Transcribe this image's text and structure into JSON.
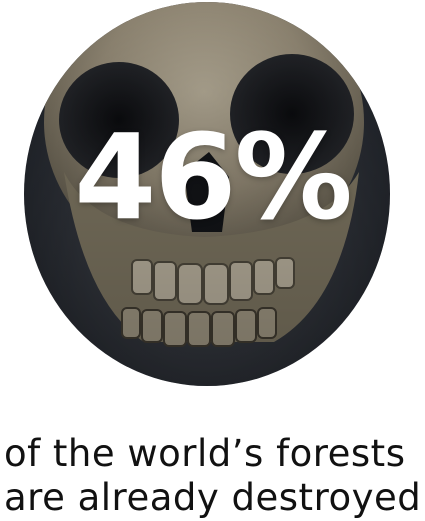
{
  "stat": {
    "value": "46%"
  },
  "caption": {
    "line1": "of the world’s forests",
    "line2": "are already destroyed"
  },
  "image": {
    "subject": "skull",
    "shape": "circle",
    "colors": {
      "background": "#ffffff",
      "bone": "#b8ad97",
      "shadow": "#1c1f25",
      "text_on_image": "#ffffff",
      "caption_text": "#111111"
    }
  }
}
